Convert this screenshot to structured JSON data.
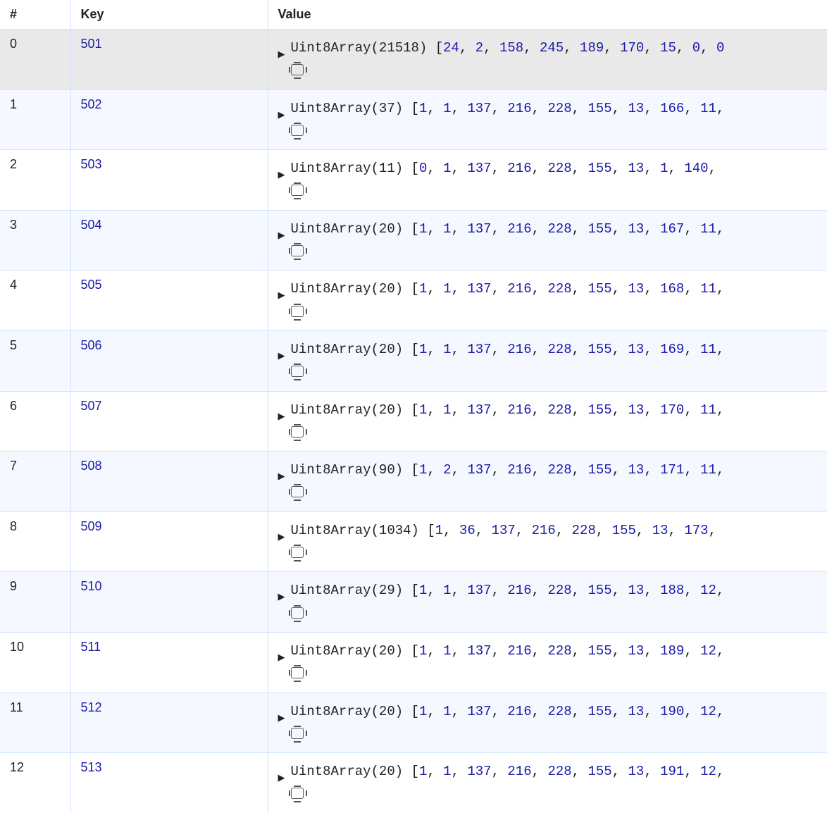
{
  "headers": {
    "index": "#",
    "key": "Key",
    "value": "Value"
  },
  "type_name": "Uint8Array",
  "rows": [
    {
      "index": "0",
      "key": "501",
      "selected": true,
      "length": "21518",
      "nums": [
        "24",
        "2",
        "158",
        "245",
        "189",
        "170",
        "15",
        "0",
        "0"
      ],
      "trailing_comma": false
    },
    {
      "index": "1",
      "key": "502",
      "selected": false,
      "length": "37",
      "nums": [
        "1",
        "1",
        "137",
        "216",
        "228",
        "155",
        "13",
        "166",
        "11"
      ],
      "trailing_comma": true
    },
    {
      "index": "2",
      "key": "503",
      "selected": false,
      "length": "11",
      "nums": [
        "0",
        "1",
        "137",
        "216",
        "228",
        "155",
        "13",
        "1",
        "140"
      ],
      "trailing_comma": true
    },
    {
      "index": "3",
      "key": "504",
      "selected": false,
      "length": "20",
      "nums": [
        "1",
        "1",
        "137",
        "216",
        "228",
        "155",
        "13",
        "167",
        "11"
      ],
      "trailing_comma": true
    },
    {
      "index": "4",
      "key": "505",
      "selected": false,
      "length": "20",
      "nums": [
        "1",
        "1",
        "137",
        "216",
        "228",
        "155",
        "13",
        "168",
        "11"
      ],
      "trailing_comma": true
    },
    {
      "index": "5",
      "key": "506",
      "selected": false,
      "length": "20",
      "nums": [
        "1",
        "1",
        "137",
        "216",
        "228",
        "155",
        "13",
        "169",
        "11"
      ],
      "trailing_comma": true
    },
    {
      "index": "6",
      "key": "507",
      "selected": false,
      "length": "20",
      "nums": [
        "1",
        "1",
        "137",
        "216",
        "228",
        "155",
        "13",
        "170",
        "11"
      ],
      "trailing_comma": true
    },
    {
      "index": "7",
      "key": "508",
      "selected": false,
      "length": "90",
      "nums": [
        "1",
        "2",
        "137",
        "216",
        "228",
        "155",
        "13",
        "171",
        "11"
      ],
      "trailing_comma": true
    },
    {
      "index": "8",
      "key": "509",
      "selected": false,
      "length": "1034",
      "nums": [
        "1",
        "36",
        "137",
        "216",
        "228",
        "155",
        "13",
        "173"
      ],
      "trailing_comma": true
    },
    {
      "index": "9",
      "key": "510",
      "selected": false,
      "length": "29",
      "nums": [
        "1",
        "1",
        "137",
        "216",
        "228",
        "155",
        "13",
        "188",
        "12"
      ],
      "trailing_comma": true
    },
    {
      "index": "10",
      "key": "511",
      "selected": false,
      "length": "20",
      "nums": [
        "1",
        "1",
        "137",
        "216",
        "228",
        "155",
        "13",
        "189",
        "12"
      ],
      "trailing_comma": true
    },
    {
      "index": "11",
      "key": "512",
      "selected": false,
      "length": "20",
      "nums": [
        "1",
        "1",
        "137",
        "216",
        "228",
        "155",
        "13",
        "190",
        "12"
      ],
      "trailing_comma": true
    },
    {
      "index": "12",
      "key": "513",
      "selected": false,
      "length": "20",
      "nums": [
        "1",
        "1",
        "137",
        "216",
        "228",
        "155",
        "13",
        "191",
        "12"
      ],
      "trailing_comma": true
    }
  ]
}
